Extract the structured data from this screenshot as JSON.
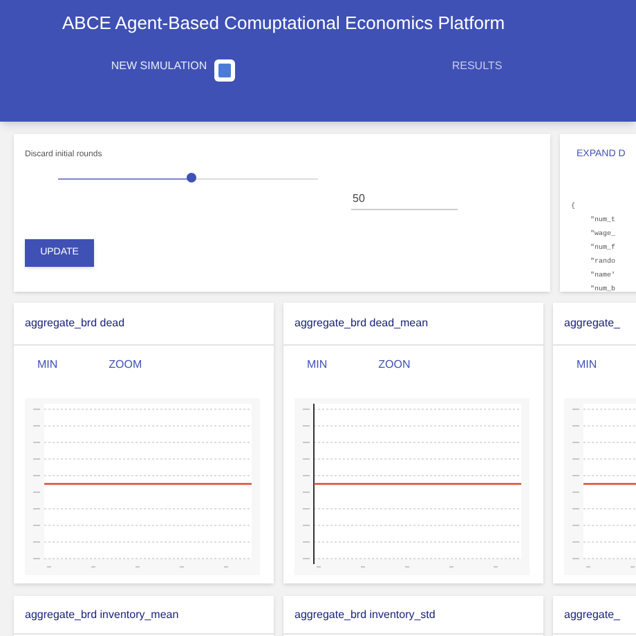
{
  "app_bar": {
    "title": "ABCE Agent-Based Comuptational Economics Platform",
    "tabs": [
      {
        "label": "NEW SIMULATION",
        "selected": true
      },
      {
        "label": "RESULTS",
        "selected": false
      }
    ]
  },
  "settings_card": {
    "slider_label": "Discard initial rounds",
    "slider": {
      "level": 0.51
    },
    "field_value": "50",
    "button": "UPDATE"
  },
  "parameters_card": {
    "button": "EXPAND D",
    "code_lines": [
      "{",
      "\"num_t",
      "\"wage_",
      "\"num_f",
      "\"rando",
      "\"name'",
      "\"num_b"
    ]
  },
  "chart_cards": [
    {
      "title": "aggregate_brd dead",
      "buttons": [
        "MIN",
        "ZOOM"
      ]
    },
    {
      "title": "aggregate_brd dead_mean",
      "buttons": [
        "MIN",
        "ZOON"
      ]
    },
    {
      "title": "aggregate_",
      "buttons": [
        "MIN"
      ]
    }
  ],
  "chart_cards_row2": [
    {
      "title": "aggregate_brd inventory_mean"
    },
    {
      "title": "aggregate_brd inventory_std"
    },
    {
      "title": "aggregate_"
    }
  ]
}
